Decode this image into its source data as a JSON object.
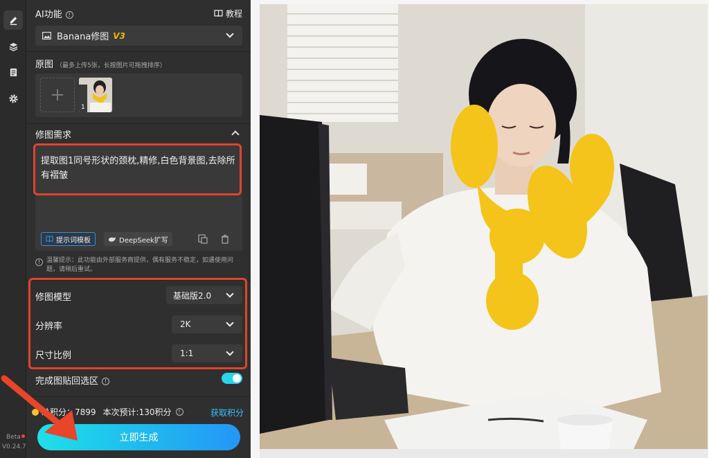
{
  "rail": {
    "items": [
      "edit",
      "layers",
      "history",
      "settings"
    ],
    "beta_label": "Beta",
    "version": "V0.24.7"
  },
  "ai_feature": {
    "title": "AI功能",
    "tutorial_label": "教程",
    "model_name": "Banana修图",
    "model_version": "V3"
  },
  "original": {
    "title": "原图",
    "hint": "（最多上传5张，长按图片可拖拽排序）",
    "thumb_index": "1"
  },
  "requirement": {
    "title": "修图需求",
    "prompt_text": "提取图1同号形状的颈枕,精修,白色背景图,去除所有褶皱",
    "template_button": "提示词模板",
    "deepseek_button": "DeepSeek扩写",
    "notice": "温馨提示：此功能由外部服务商提供，偶有服务不稳定，如遇使用问题，请稍后重试。"
  },
  "params": {
    "model_label": "修图模型",
    "model_value": "基础版2.0",
    "resolution_label": "分辨率",
    "resolution_value": "2K",
    "ratio_label": "尺寸比例",
    "ratio_value": "1:1"
  },
  "paste_back": {
    "label": "完成图贴回选区",
    "enabled": true
  },
  "footer": {
    "credits_text": "总积分：7899",
    "estimate_text": "本次预计:130积分",
    "get_credits": "获取积分",
    "generate_button": "立即生成"
  },
  "colors": {
    "accent": "#2ad4e8",
    "highlight_frame": "#e0442a",
    "link": "#35c3ff"
  }
}
